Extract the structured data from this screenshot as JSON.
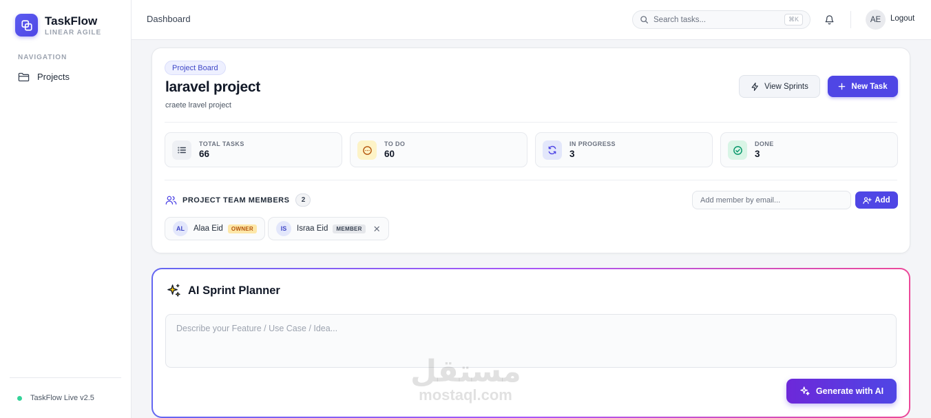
{
  "brand": {
    "name": "TaskFlow",
    "subtitle": "LINEAR AGILE"
  },
  "sidebar": {
    "heading": "NAVIGATION",
    "items": [
      {
        "label": "Projects",
        "icon": "folder-icon"
      }
    ],
    "footer": {
      "version": "TaskFlow Live v2.5",
      "status_color": "#34d399"
    }
  },
  "topbar": {
    "breadcrumb": "Dashboard",
    "search": {
      "placeholder": "Search tasks...",
      "shortcut": "⌘K"
    },
    "user": {
      "initials": "AE",
      "logout_label": "Logout"
    }
  },
  "project": {
    "badge": "Project Board",
    "title": "laravel project",
    "description": "craete lravel project",
    "actions": {
      "view_sprints": "View Sprints",
      "new_task": "New Task"
    },
    "stats": [
      {
        "label": "TOTAL TASKS",
        "value": "66",
        "icon": "list-icon",
        "color": "#eef0f4"
      },
      {
        "label": "TO DO",
        "value": "60",
        "icon": "clock-icon",
        "color": "#fdf3c7"
      },
      {
        "label": "IN PROGRESS",
        "value": "3",
        "icon": "refresh-icon",
        "color": "#e3e7fb"
      },
      {
        "label": "DONE",
        "value": "3",
        "icon": "check-circle-icon",
        "color": "#d9f5e6"
      }
    ],
    "team": {
      "title": "PROJECT TEAM MEMBERS",
      "count": "2",
      "add_placeholder": "Add member by email...",
      "add_label": "Add",
      "members": [
        {
          "initials": "AL",
          "name": "Alaa Eid",
          "role": "OWNER"
        },
        {
          "initials": "IS",
          "name": "Israa Eid",
          "role": "MEMBER"
        }
      ]
    }
  },
  "ai": {
    "title": "AI Sprint Planner",
    "placeholder": "Describe your Feature / Use Case / Idea...",
    "generate_label": "Generate with AI"
  },
  "watermark": {
    "arabic": "مستقل",
    "latin": "mostaql.com"
  },
  "colors": {
    "accent": "#4f46e5",
    "owner_badge": "#fde7a8",
    "member_badge": "#e5e7eb"
  }
}
